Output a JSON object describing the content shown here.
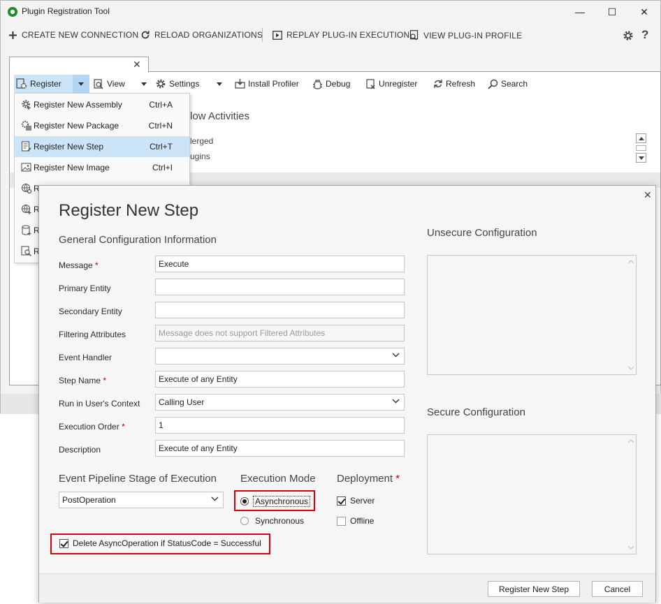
{
  "window": {
    "title": "Plugin Registration Tool",
    "minimize": "—",
    "maximize": "☐",
    "close": "✕"
  },
  "connection_toolbar": {
    "create": "CREATE NEW CONNECTION",
    "reload": "RELOAD ORGANIZATIONS",
    "replay": "REPLAY PLUG-IN EXECUTION",
    "view_profile": "VIEW PLUG-IN PROFILE"
  },
  "tab": {
    "close": "✕"
  },
  "org_toolbar": {
    "register": "Register",
    "view": "View",
    "settings": "Settings",
    "install_profiler": "Install Profiler",
    "debug": "Debug",
    "unregister": "Unregister",
    "refresh": "Refresh",
    "search": "Search"
  },
  "background": {
    "activities_fragment": "low Activities",
    "merged_fragment": "lerged",
    "plugins_fragment": "ugins"
  },
  "register_menu": {
    "items": [
      {
        "label": "Register New Assembly",
        "shortcut": "Ctrl+A",
        "icon": "gear-assembly-icon"
      },
      {
        "label": "Register New Package",
        "shortcut": "Ctrl+N",
        "icon": "package-icon"
      },
      {
        "label": "Register New Step",
        "shortcut": "Ctrl+T",
        "icon": "step-icon"
      },
      {
        "label": "Register New Image",
        "shortcut": "Ctrl+I",
        "icon": "image-icon"
      },
      {
        "label": "R",
        "shortcut": "",
        "icon": "globe-gear-icon"
      },
      {
        "label": "R",
        "shortcut": "",
        "icon": "globe-icon"
      },
      {
        "label": "R",
        "shortcut": "",
        "icon": "database-icon"
      },
      {
        "label": "R",
        "shortcut": "",
        "icon": "search-doc-icon"
      }
    ],
    "selected_index": 2
  },
  "dialog": {
    "title": "Register New Step",
    "close": "✕",
    "general_heading": "General Configuration Information",
    "fields": {
      "message": {
        "label": "Message",
        "required": "*",
        "value": "Execute"
      },
      "primary_entity": {
        "label": "Primary Entity",
        "value": ""
      },
      "secondary_entity": {
        "label": "Secondary Entity",
        "value": ""
      },
      "filtering_attributes": {
        "label": "Filtering Attributes",
        "placeholder": "Message does not support Filtered Attributes"
      },
      "event_handler": {
        "label": "Event Handler",
        "value": ""
      },
      "step_name": {
        "label": "Step Name",
        "required": "*",
        "value": "Execute of any Entity"
      },
      "run_context": {
        "label": "Run in User's Context",
        "value": "Calling User"
      },
      "execution_order": {
        "label": "Execution Order",
        "required": "*",
        "value": "1"
      },
      "description": {
        "label": "Description",
        "value": "Execute of any Entity"
      }
    },
    "pipeline": {
      "heading": "Event Pipeline Stage of Execution",
      "value": "PostOperation"
    },
    "execution_mode": {
      "heading": "Execution Mode",
      "asynchronous": "Asynchronous",
      "synchronous": "Synchronous",
      "selected": "asynchronous"
    },
    "deployment": {
      "heading": "Deployment",
      "required": "*",
      "server": "Server",
      "offline": "Offline",
      "server_checked": true,
      "offline_checked": false
    },
    "delete_async": {
      "label": "Delete AsyncOperation if StatusCode = Successful",
      "checked": true
    },
    "unsecure_heading": "Unsecure  Configuration",
    "secure_heading": "Secure  Configuration",
    "buttons": {
      "register": "Register New Step",
      "cancel": "Cancel"
    }
  },
  "colors": {
    "selection": "#cce4f7",
    "highlight_border": "#d8000c",
    "required": "#c00000",
    "app_icon": "#1e8a2e"
  }
}
